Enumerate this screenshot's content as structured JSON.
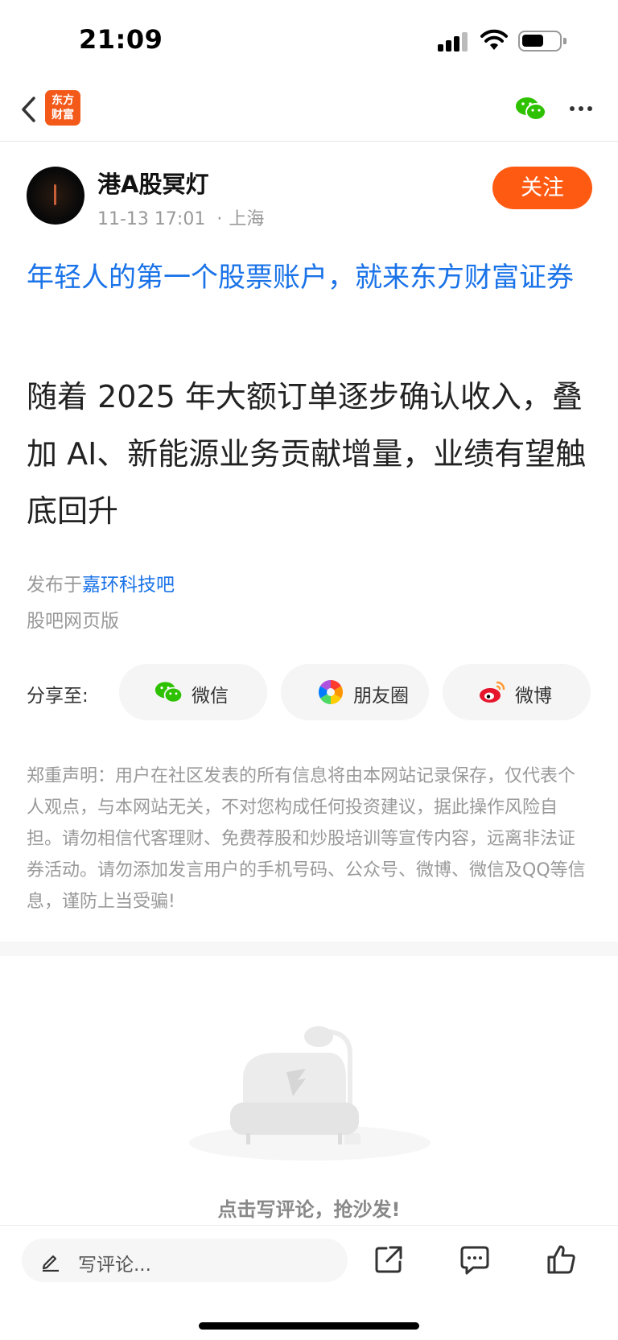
{
  "status_bar": {
    "time": "21:09"
  },
  "nav": {
    "logo_text_line1": "东方",
    "logo_text_line2": "财富",
    "icons": [
      "back-icon",
      "wechat-icon",
      "more-icon"
    ]
  },
  "author": {
    "name": "港A股冥灯",
    "date": "11-13 17:01",
    "location": "上海",
    "follow_label": "关注"
  },
  "promo_link": "年轻人的第一个股票账户，就来东方财富证券",
  "post": {
    "content": "随着 2025 年大额订单逐步确认收入，叠加 AI、新能源业务贡献增量，业绩有望触底回升",
    "published_prefix": "发布于",
    "published_bar": "嘉环科技吧",
    "web_version": "股吧网页版"
  },
  "share": {
    "label": "分享至:",
    "options": [
      {
        "label": "微信",
        "icon": "wechat-icon"
      },
      {
        "label": "朋友圈",
        "icon": "moments-icon"
      },
      {
        "label": "微博",
        "icon": "weibo-icon"
      }
    ]
  },
  "disclaimer": "郑重声明：用户在社区发表的所有信息将由本网站记录保存，仅代表个人观点，与本网站无关，不对您构成任何投资建议，据此操作风险自担。请勿相信代客理财、免费荐股和炒股培训等宣传内容，远离非法证券活动。请勿添加发言用户的手机号码、公众号、微博、微信及QQ等信息，谨防上当受骗!",
  "comments": {
    "empty_text": "点击写评论，抢沙发!"
  },
  "bottom_bar": {
    "placeholder": "写评论...",
    "icons": [
      "share-icon",
      "comment-icon",
      "like-icon"
    ]
  },
  "colors": {
    "accent": "#ff5a12",
    "link": "#1a73e8",
    "wechat": "#2dc100"
  }
}
